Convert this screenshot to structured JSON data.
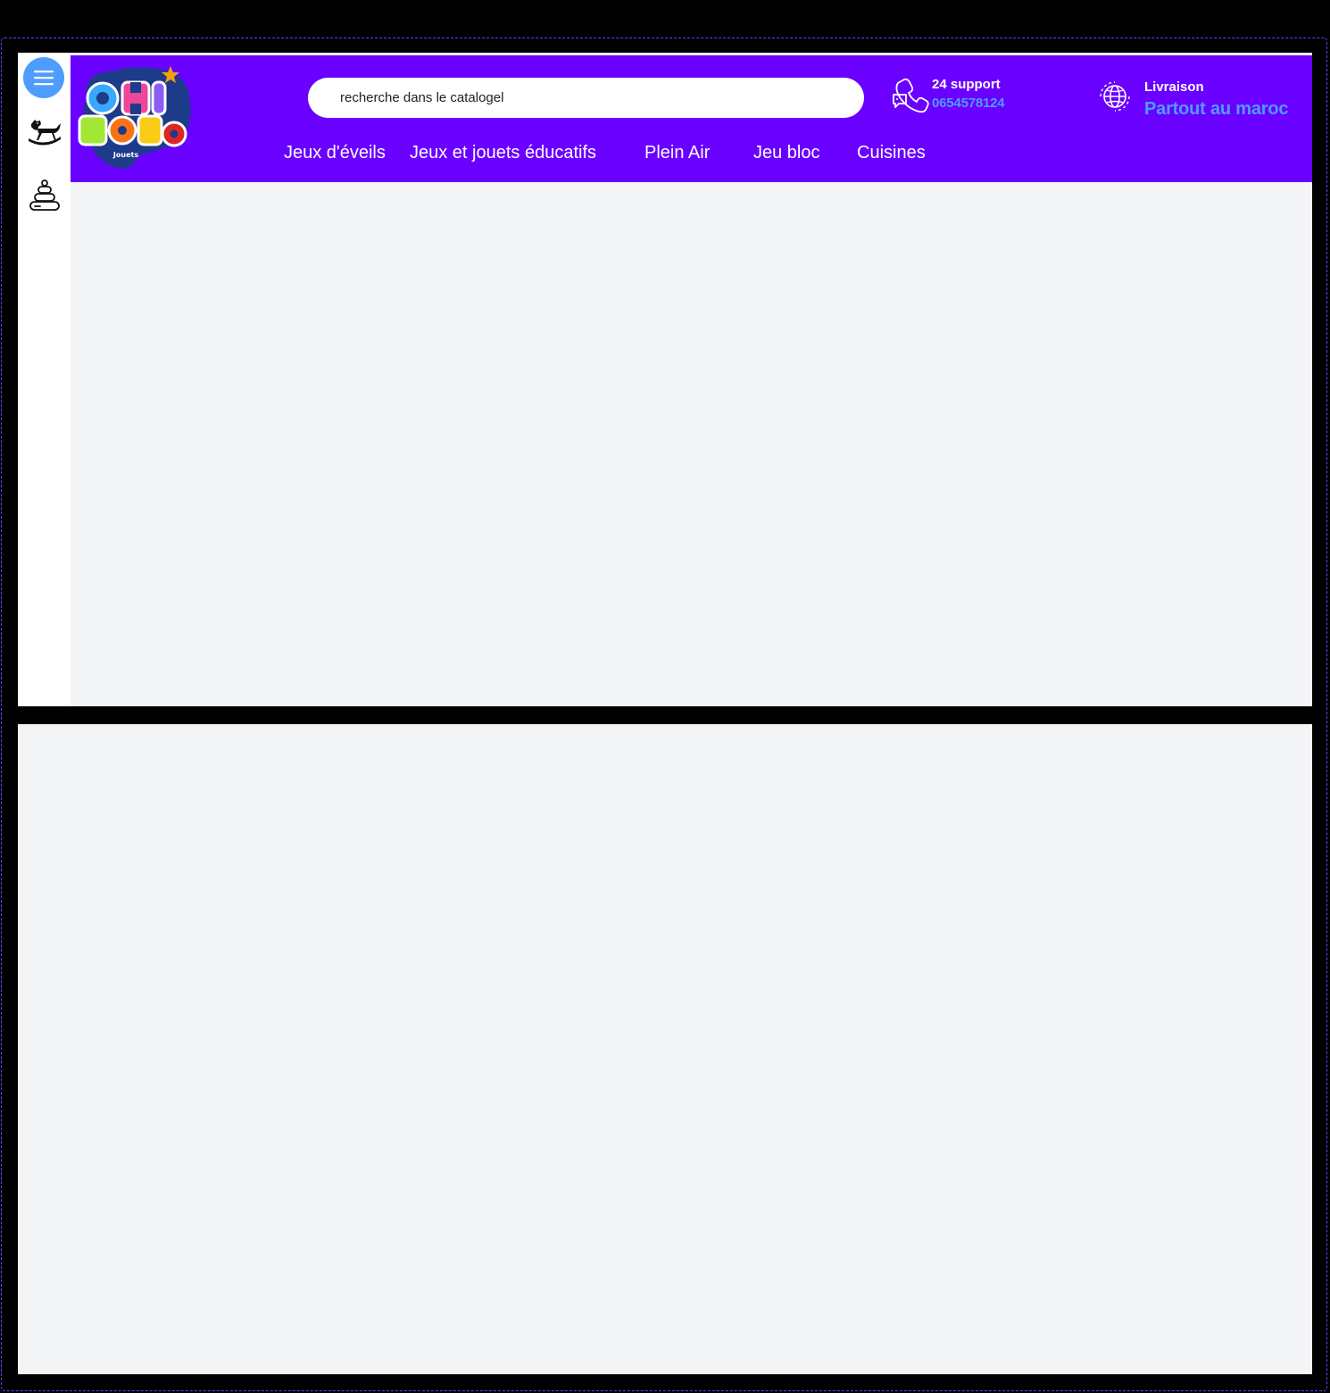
{
  "header": {
    "search": {
      "text": "recherche dans le catalogel"
    },
    "support": {
      "label": "24 support",
      "phone": "0654578124"
    },
    "delivery": {
      "label": "Livraison",
      "area": "Partout au maroc"
    },
    "nav": [
      {
        "label": "Jeux d'éveils"
      },
      {
        "label": "Jeux et jouets éducatifs"
      },
      {
        "label": "Plein Air"
      },
      {
        "label": "Jeu bloc"
      },
      {
        "label": "Cuisines"
      }
    ]
  },
  "sidebar": {
    "items": [
      {
        "icon": "hamburger-menu-icon"
      },
      {
        "icon": "rocking-horse-icon"
      },
      {
        "icon": "stacking-rings-toy-icon"
      }
    ]
  },
  "logo": {
    "alt": "Chinono Jouets"
  },
  "colors": {
    "header_bg": "#6a00ff",
    "accent_blue": "#4f9cff",
    "page_bg": "#f3f4f6",
    "sidebar_bg": "#ffffff"
  }
}
